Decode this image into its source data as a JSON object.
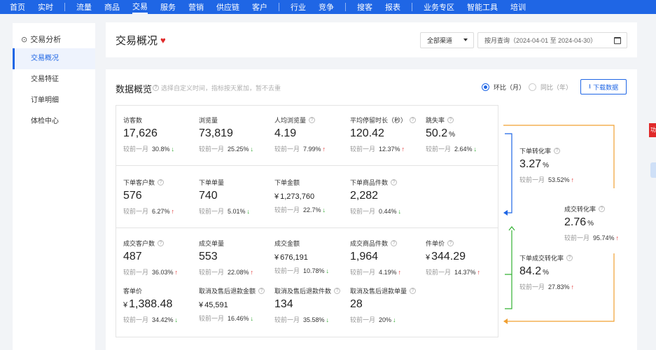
{
  "nav": {
    "items": [
      "首页",
      "实时",
      "流量",
      "商品",
      "交易",
      "服务",
      "营销",
      "供应链",
      "客户",
      "行业",
      "竞争",
      "搜客",
      "报表",
      "业务专区",
      "智能工具",
      "培训"
    ],
    "active": "交易"
  },
  "sidebar": {
    "title": "交易分析",
    "items": [
      "交易概况",
      "交易特征",
      "订单明细",
      "体检中心"
    ],
    "active": "交易概况"
  },
  "header": {
    "title": "交易概况",
    "channel": "全部渠道",
    "date_label": "按月查询",
    "date_value": "2024-04-01 至 2024-04-30"
  },
  "section": {
    "title": "数据概览",
    "hint": "选择自定义时间，指标按天累加，暂不去重",
    "radio_mom": "环比（月）",
    "radio_yoy": "同比（年）",
    "download": "下载数据",
    "compare_label": "较前一月"
  },
  "metrics": {
    "visitors": {
      "label": "访客数",
      "value": "17,626",
      "pct": "30.8%",
      "trend": "down"
    },
    "pageviews": {
      "label": "浏览量",
      "value": "73,819",
      "pct": "25.25%",
      "trend": "down"
    },
    "pv_per_visitor": {
      "label": "人均浏览量",
      "value": "4.19",
      "pct": "7.99%",
      "trend": "up"
    },
    "avg_stay": {
      "label": "平均停留时长（秒）",
      "value": "120.42",
      "pct": "12.37%",
      "trend": "up"
    },
    "bounce": {
      "label": "跳失率",
      "value": "50.2",
      "unit": "%",
      "pct": "2.64%",
      "trend": "down"
    },
    "order_customers": {
      "label": "下单客户数",
      "value": "576",
      "pct": "6.27%",
      "trend": "up"
    },
    "order_count": {
      "label": "下单单量",
      "value": "740",
      "pct": "5.01%",
      "trend": "down"
    },
    "order_amount": {
      "label": "下单金额",
      "value": "1,273,760",
      "pct": "22.7%",
      "trend": "down"
    },
    "order_items": {
      "label": "下单商品件数",
      "value": "2,282",
      "pct": "0.44%",
      "trend": "down"
    },
    "deal_customers": {
      "label": "成交客户数",
      "value": "487",
      "pct": "36.03%",
      "trend": "up"
    },
    "deal_count": {
      "label": "成交单量",
      "value": "553",
      "pct": "22.08%",
      "trend": "up"
    },
    "deal_amount": {
      "label": "成交金额",
      "value": "676,191",
      "pct": "10.78%",
      "trend": "down"
    },
    "deal_items": {
      "label": "成交商品件数",
      "value": "1,964",
      "pct": "4.19%",
      "trend": "up"
    },
    "unit_price": {
      "label": "件单价",
      "value": "344.29",
      "pct": "14.37%",
      "trend": "up"
    },
    "customer_price": {
      "label": "客单价",
      "value": "1,388.48",
      "pct": "34.42%",
      "trend": "down"
    },
    "cancel_amount": {
      "label": "取消及售后退款金额",
      "value": "45,591",
      "pct": "16.46%",
      "trend": "down"
    },
    "cancel_items": {
      "label": "取消及售后退款件数",
      "value": "134",
      "pct": "35.58%",
      "trend": "down"
    },
    "cancel_orders": {
      "label": "取消及售后退款单量",
      "value": "28",
      "pct": "20%",
      "trend": "down"
    }
  },
  "conversion": {
    "order_rate": {
      "label": "下单转化率",
      "value": "3.27",
      "unit": "%",
      "pct": "53.52%",
      "trend": "up"
    },
    "deal_rate": {
      "label": "成交转化率",
      "value": "2.76",
      "unit": "%",
      "pct": "95.74%",
      "trend": "up"
    },
    "order_deal_rate": {
      "label": "下单成交转化率",
      "value": "84.2",
      "unit": "%",
      "pct": "27.83%",
      "trend": "up"
    }
  },
  "colors": {
    "primary": "#1f66e5",
    "up": "#e02a2a",
    "down": "#2aa52a",
    "flow_orange": "#f0a032",
    "flow_blue": "#1f66e5",
    "flow_green": "#33b233"
  },
  "right_tab": "功",
  "symbols": {
    "currency": "¥",
    "up": "↑",
    "down": "↓",
    "q": "?"
  }
}
